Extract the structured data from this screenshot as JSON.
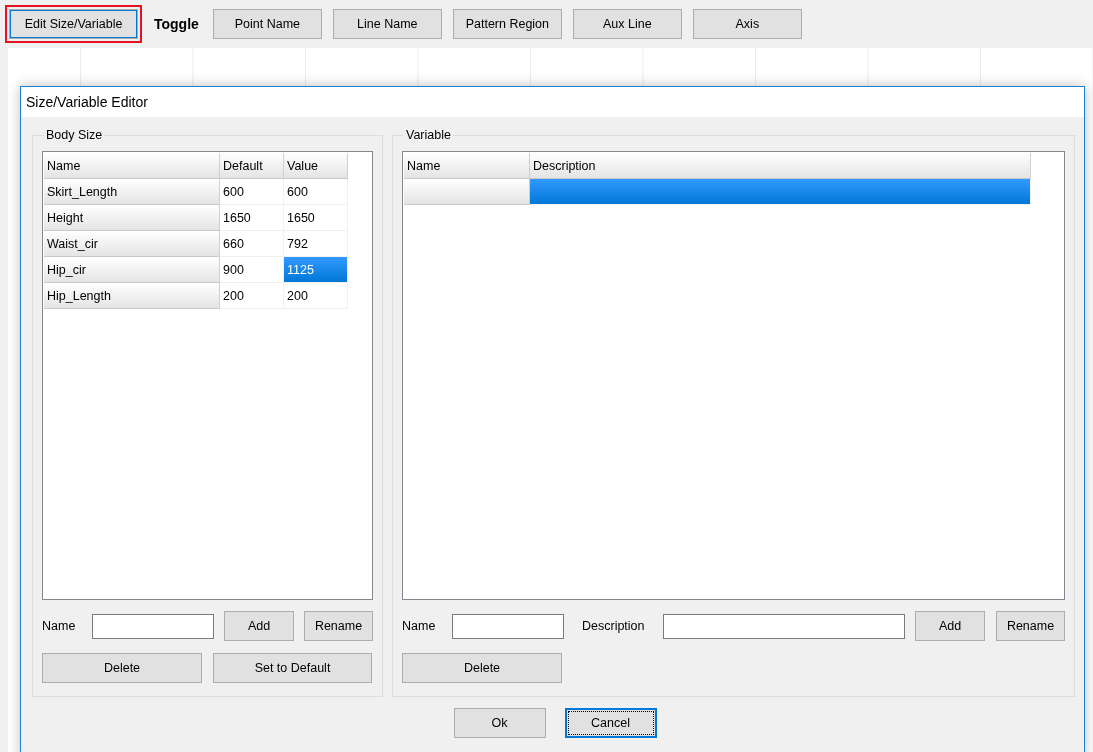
{
  "toolbar": {
    "buttons": [
      {
        "label": "Edit Size/Variable",
        "highlighted": true
      }
    ],
    "toggle_label": "Toggle",
    "toggle_buttons": [
      {
        "label": "Point Name"
      },
      {
        "label": "Line Name"
      },
      {
        "label": "Pattern Region"
      },
      {
        "label": "Aux Line"
      },
      {
        "label": "Axis"
      }
    ]
  },
  "dialog": {
    "title": "Size/Variable Editor",
    "body_size": {
      "title": "Body Size",
      "columns": [
        "Name",
        "Default",
        "Value"
      ],
      "rows": [
        {
          "name": "Skirt_Length",
          "default": "600",
          "value": "600",
          "selected": false
        },
        {
          "name": "Height",
          "default": "1650",
          "value": "1650",
          "selected": false
        },
        {
          "name": "Waist_cir",
          "default": "660",
          "value": "792",
          "selected": false
        },
        {
          "name": "Hip_cir",
          "default": "900",
          "value": "1125",
          "selected": true
        },
        {
          "name": "Hip_Length",
          "default": "200",
          "value": "200",
          "selected": false
        }
      ],
      "name_label": "Name",
      "buttons": [
        "Add",
        "Rename"
      ],
      "bottom_buttons": [
        "Delete",
        "Set to Default"
      ]
    },
    "variable": {
      "title": "Variable",
      "columns": [
        "Name",
        "Description"
      ],
      "rows": [
        {
          "selected": true
        }
      ],
      "name_label": "Name",
      "description_label": "Description",
      "buttons": [
        "Add",
        "Rename"
      ],
      "bottom_buttons": [
        "Delete"
      ]
    },
    "buttons": [
      {
        "label": "Ok",
        "focused": false
      },
      {
        "label": "Cancel",
        "focused": true
      }
    ]
  }
}
